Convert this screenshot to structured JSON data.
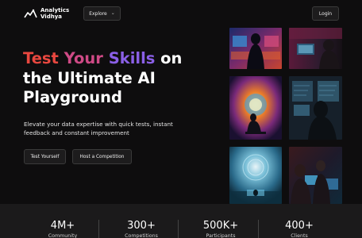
{
  "header": {
    "logo_line1": "Analytics",
    "logo_line2": "Vidhya",
    "explore_label": "Explore",
    "login_label": "Login"
  },
  "hero": {
    "title_word1": "Test",
    "title_word2": "Your",
    "title_word3": "Skills",
    "title_rest1": " on",
    "title_line2": "the Ultimate AI",
    "title_line3": "Playground",
    "subtitle": "Elevate your data expertise with quick tests, instant feedback and constant improvement",
    "cta_test": "Test Yourself",
    "cta_host": "Host a Competition"
  },
  "stats": [
    {
      "value": "4M+",
      "label": "Community"
    },
    {
      "value": "300+",
      "label": "Competitions"
    },
    {
      "value": "500K+",
      "label": "Participants"
    },
    {
      "value": "400+",
      "label": "Clients"
    }
  ],
  "colors": {
    "background": "#0e0d0e",
    "accent_red": "#e8473f",
    "accent_pink": "#cf4a86",
    "accent_purple": "#8a5fe6"
  }
}
